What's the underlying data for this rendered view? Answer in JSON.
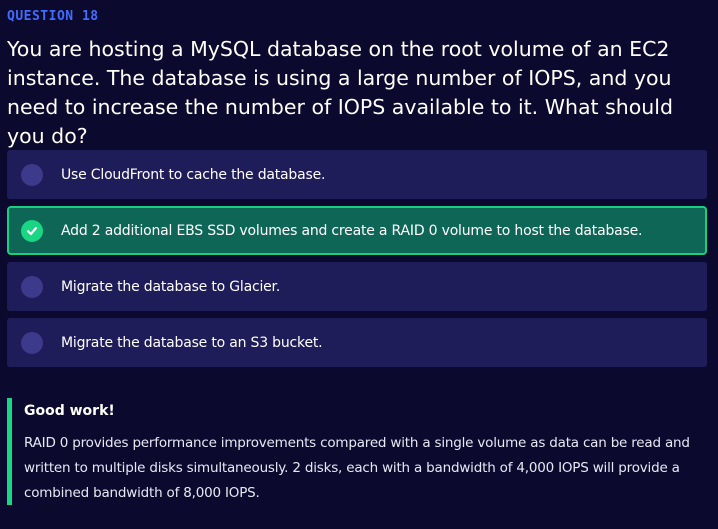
{
  "question": {
    "label": "QUESTION 18",
    "text": "You are hosting a MySQL database on the root volume of an EC2 instance. The database is using a large number of IOPS, and you need to increase the number of IOPS available to it. What should you do?"
  },
  "options": [
    {
      "label": "Use CloudFront to cache the database.",
      "selected": false
    },
    {
      "label": "Add 2 additional EBS SSD volumes and create a RAID 0 volume to host the database.",
      "selected": true
    },
    {
      "label": "Migrate the database to Glacier.",
      "selected": false
    },
    {
      "label": "Migrate the database to an S3 bucket.",
      "selected": false
    }
  ],
  "feedback": {
    "title": "Good work!",
    "body": "RAID 0 provides performance improvements compared with a single volume as data can be read and written to multiple disks simultaneously. 2 disks, each with a bandwidth of 4,000 IOPS will provide a combined bandwidth of 8,000 IOPS."
  },
  "colors": {
    "background": "#0b0a2e",
    "accent": "#3f6dff",
    "correct": "#19d683",
    "option_bg": "#1f1c5a",
    "selected_bg": "#0e6656"
  },
  "icons": {
    "selected": "checkmark-icon",
    "unselected": "radio-circle-icon"
  }
}
